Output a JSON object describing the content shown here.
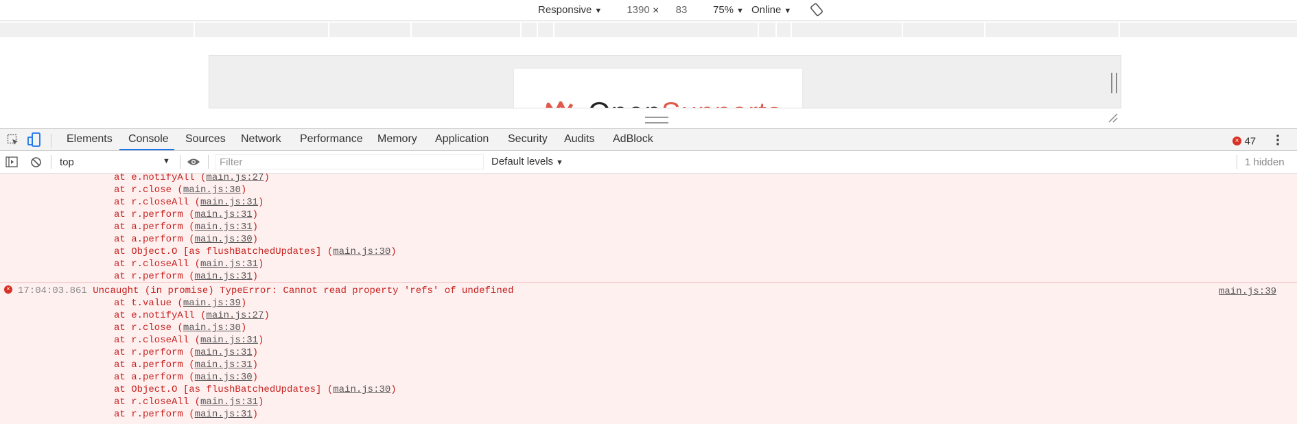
{
  "device_toolbar": {
    "device": "Responsive",
    "width": "1390",
    "times": "×",
    "height": "83",
    "zoom": "75%",
    "network": "Online"
  },
  "viewport": {
    "logo_text_a": "Open",
    "logo_text_b": "Supports"
  },
  "tabs": [
    "Elements",
    "Console",
    "Sources",
    "Network",
    "Performance",
    "Memory",
    "Application",
    "Security",
    "Audits",
    "AdBlock"
  ],
  "error_count": "47",
  "console_bar": {
    "context": "top",
    "filter_placeholder": "Filter",
    "levels": "Default levels",
    "hidden": "1 hidden"
  },
  "log_block_1": [
    {
      "pre": "at e.notifyAll (",
      "link": "main.js:27",
      "post": ")"
    },
    {
      "pre": "at r.close (",
      "link": "main.js:30",
      "post": ")"
    },
    {
      "pre": "at r.closeAll (",
      "link": "main.js:31",
      "post": ")"
    },
    {
      "pre": "at r.perform (",
      "link": "main.js:31",
      "post": ")"
    },
    {
      "pre": "at a.perform (",
      "link": "main.js:31",
      "post": ")"
    },
    {
      "pre": "at a.perform (",
      "link": "main.js:30",
      "post": ")"
    },
    {
      "pre": "at Object.O [as flushBatchedUpdates] (",
      "link": "main.js:30",
      "post": ")"
    },
    {
      "pre": "at r.closeAll (",
      "link": "main.js:31",
      "post": ")"
    },
    {
      "pre": "at r.perform (",
      "link": "main.js:31",
      "post": ")"
    }
  ],
  "error_2": {
    "timestamp": "17:04:03.861",
    "message": "Uncaught (in promise) TypeError: Cannot read property 'refs' of undefined",
    "source": "main.js:39"
  },
  "log_block_2": [
    {
      "pre": "at t.value (",
      "link": "main.js:39",
      "post": ")"
    },
    {
      "pre": "at e.notifyAll (",
      "link": "main.js:27",
      "post": ")"
    },
    {
      "pre": "at r.close (",
      "link": "main.js:30",
      "post": ")"
    },
    {
      "pre": "at r.closeAll (",
      "link": "main.js:31",
      "post": ")"
    },
    {
      "pre": "at r.perform (",
      "link": "main.js:31",
      "post": ")"
    },
    {
      "pre": "at a.perform (",
      "link": "main.js:31",
      "post": ")"
    },
    {
      "pre": "at a.perform (",
      "link": "main.js:30",
      "post": ")"
    },
    {
      "pre": "at Object.O [as flushBatchedUpdates] (",
      "link": "main.js:30",
      "post": ")"
    },
    {
      "pre": "at r.closeAll (",
      "link": "main.js:31",
      "post": ")"
    },
    {
      "pre": "at r.perform (",
      "link": "main.js:31",
      "post": ")"
    }
  ],
  "colors": {
    "error_text": "#c5221f",
    "error_bg": "#fff0f0",
    "accent": "#1a73e8",
    "logo_accent": "#e0594b"
  }
}
